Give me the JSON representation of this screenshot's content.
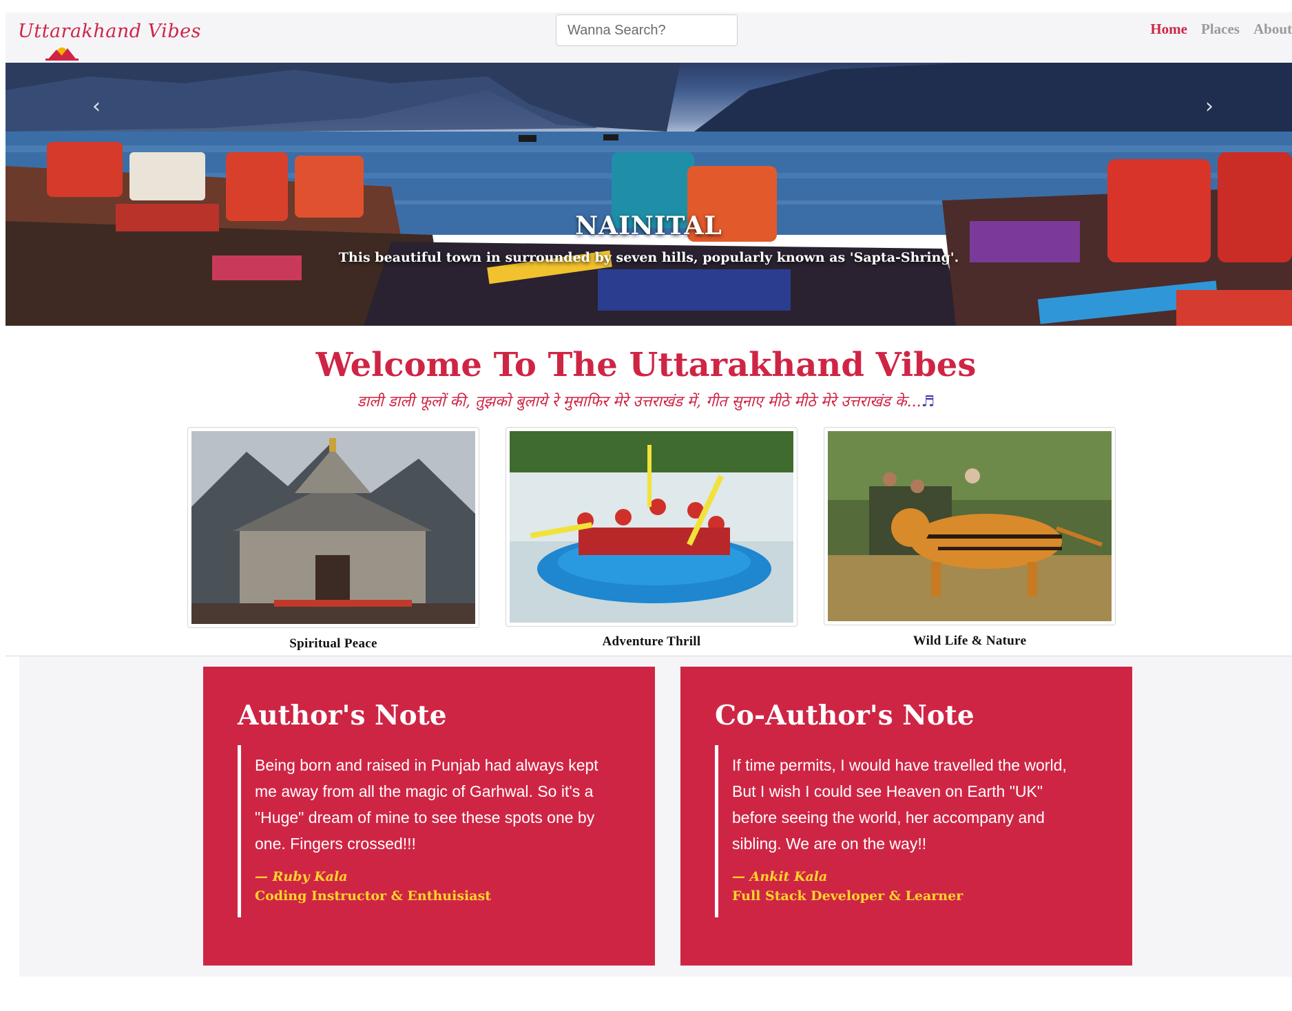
{
  "navbar": {
    "brand": "Uttarakhand Vibes",
    "search_placeholder": "Wanna Search?",
    "links": [
      "Home",
      "Places",
      "About"
    ],
    "active_link": "Home"
  },
  "hero": {
    "title": "NAINITAL",
    "subtitle": "This beautiful town in surrounded by seven hills, popularly known as 'Sapta-Shring'.",
    "prev": "‹",
    "next": "›"
  },
  "welcome": {
    "title": "Welcome To The Uttarakhand Vibes",
    "subtitle": "डाली डाली फूलों की, तुझको बुलाये रे मुसाफिर मेरे उत्तराखंड में, गीत सुनाए मीठे मीठे मेरे उत्तराखंड के...",
    "note_glyph": "♬"
  },
  "cards": [
    {
      "caption": "Spiritual Peace"
    },
    {
      "caption": "Adventure Thrill"
    },
    {
      "caption": "Wild Life & Nature"
    }
  ],
  "notes": [
    {
      "title": "Author's Note",
      "body": "Being born and raised in Punjab had always kept me away from all the magic of Garhwal. So it's a \"Huge\" dream of mine to see these spots one by one. Fingers crossed!!!",
      "author": "— Ruby Kala",
      "role": "Coding Instructor & Enthuisiast"
    },
    {
      "title": "Co-Author's Note",
      "body": "If time permits, I would have travelled the world, But I wish I could see Heaven on Earth \"UK\" before seeing the world, her accompany and sibling. We are on the way!!",
      "author": "— Ankit Kala",
      "role": "Full Stack Developer & Learner"
    }
  ],
  "colors": {
    "accent": "#cf2545",
    "quote_author": "#ffd62a",
    "muted_nav": "#9a9a9a"
  }
}
